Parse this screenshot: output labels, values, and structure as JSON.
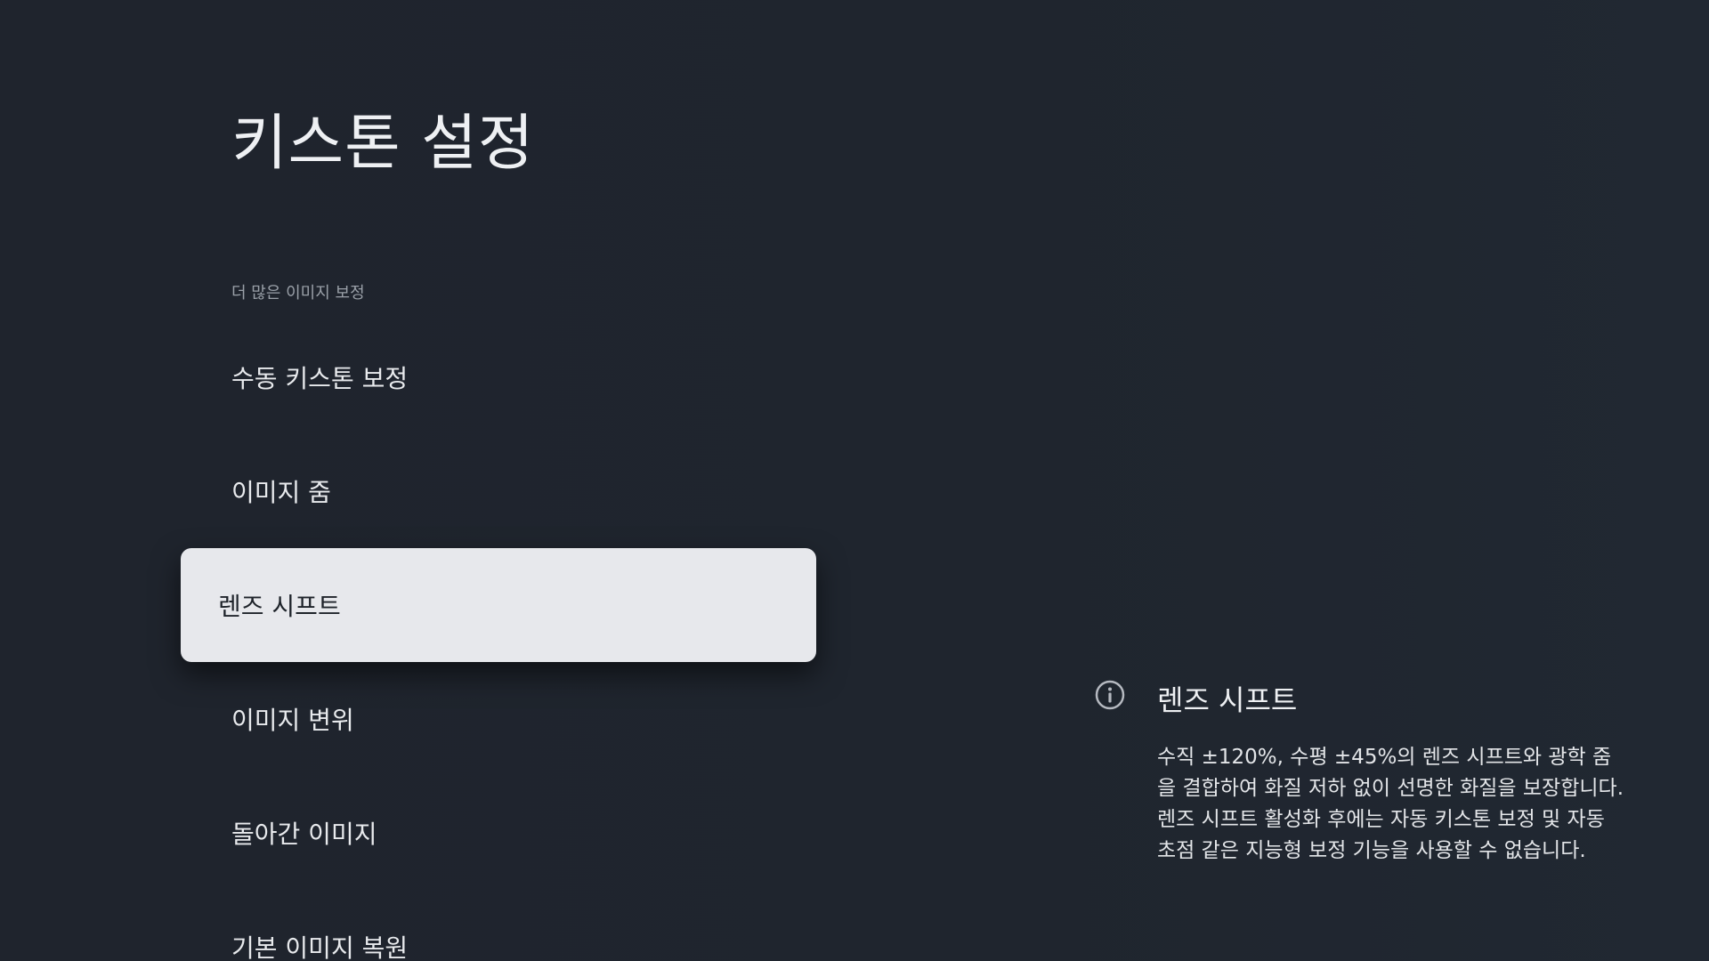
{
  "header": {
    "title": "키스톤 설정"
  },
  "menu": {
    "section_label": "더 많은 이미지 보정",
    "items": [
      {
        "label": "수동 키스톤 보정"
      },
      {
        "label": "이미지 줌"
      },
      {
        "label": "렌즈 시프트",
        "selected": true
      },
      {
        "label": "이미지 변위"
      },
      {
        "label": "돌아간 이미지"
      },
      {
        "label": "기본 이미지 복원"
      }
    ]
  },
  "info": {
    "icon": "info-circle-icon",
    "title": "렌즈 시프트",
    "description": "수직 ±120%, 수평 ±45%의 렌즈 시프트와 광학 줌을 결합하여 화질 저하 없이 선명한 화질을 보장합니다. 렌즈 시프트 활성화 후에는 자동 키스톤 보정 및 자동 초점 같은 지능형 보정 기능을 사용할 수 없습니다."
  },
  "colors": {
    "background": "#1f252e",
    "selected_background": "#e7e8ec",
    "selected_text": "#1e232a",
    "text": "#e8eaed",
    "muted_text": "#9aa0a8"
  }
}
